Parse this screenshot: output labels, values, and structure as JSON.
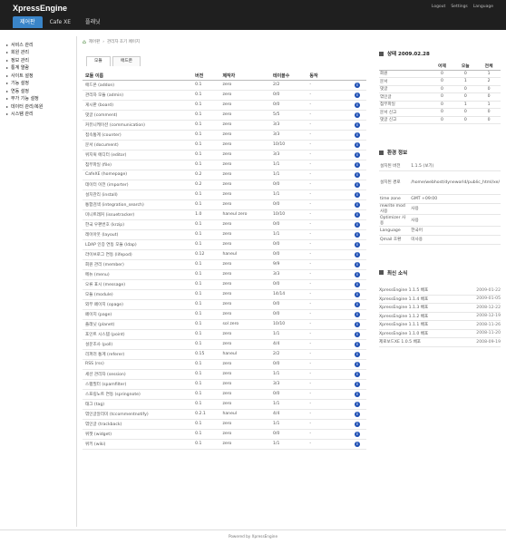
{
  "app": {
    "brand": "XpressEngine",
    "nav": [
      "제어판",
      "Cafe XE",
      "플래닛"
    ],
    "top_links": [
      "Logout",
      "Settings",
      "Language"
    ],
    "footer": "Powered by XpressEngine"
  },
  "sidebar": {
    "items": [
      "서비스 관리",
      "회원 관리",
      "정보 관리",
      "통계 열람",
      "사이트 설정",
      "기능 설정",
      "연동 설정",
      "부가 기능 설정",
      "데이터 관리/복원",
      "시스템 관리"
    ]
  },
  "main": {
    "breadcrumb": [
      "제어판",
      "관리자 초기 페이지"
    ],
    "tabs": [
      "모듈",
      "애드온"
    ],
    "columns": [
      "모듈 이름",
      "버전",
      "제작자",
      "테이블수",
      "동작"
    ],
    "rows": [
      [
        "애드온 (addon)",
        "0.1",
        "zero",
        "2/2",
        "-"
      ],
      [
        "관리자 모듈 (admin)",
        "0.1",
        "zero",
        "0/0",
        "-"
      ],
      [
        "게시판 (board)",
        "0.1",
        "zero",
        "0/0",
        "-"
      ],
      [
        "댓글 (comment)",
        "0.1",
        "zero",
        "5/5",
        "-"
      ],
      [
        "커뮤니케이션 (communication)",
        "0.1",
        "zero",
        "3/3",
        "-"
      ],
      [
        "접속통계 (counter)",
        "0.1",
        "zero",
        "3/3",
        "-"
      ],
      [
        "문서 (document)",
        "0.1",
        "zero",
        "10/10",
        "-"
      ],
      [
        "위지윅 에디터 (editor)",
        "0.1",
        "zero",
        "3/3",
        "-"
      ],
      [
        "첨부파일 (file)",
        "0.1",
        "zero",
        "1/1",
        "-"
      ],
      [
        "CafeXE (homepage)",
        "0.2",
        "zero",
        "1/1",
        "-"
      ],
      [
        "데이터 이전 (importer)",
        "0.2",
        "zero",
        "0/0",
        "-"
      ],
      [
        "설치관리 (install)",
        "0.1",
        "zero",
        "1/1",
        "-"
      ],
      [
        "통합검색 (integration_search)",
        "0.1",
        "zero",
        "0/0",
        "-"
      ],
      [
        "미니트래커 (issuetracker)",
        "1.0",
        "haneul zero",
        "10/10",
        "-"
      ],
      [
        "한국 우편번호 (krzip)",
        "0.1",
        "zero",
        "0/0",
        "-"
      ],
      [
        "레이아웃 (layout)",
        "0.1",
        "zero",
        "1/1",
        "-"
      ],
      [
        "LDAP 인증 연동 모듈 (ldap)",
        "0.1",
        "zero",
        "0/0",
        "-"
      ],
      [
        "라이브로그 연동 (lifepod)",
        "0.12",
        "haneul",
        "0/0",
        "-"
      ],
      [
        "회원 관리 (member)",
        "0.1",
        "zero",
        "9/9",
        "-"
      ],
      [
        "메뉴 (menu)",
        "0.1",
        "zero",
        "3/3",
        "-"
      ],
      [
        "오류 표시 (message)",
        "0.1",
        "zero",
        "0/0",
        "-"
      ],
      [
        "모듈 (module)",
        "0.1",
        "zero",
        "14/14",
        "-"
      ],
      [
        "외부 페이지 (opage)",
        "0.1",
        "zero",
        "0/0",
        "-"
      ],
      [
        "페이지 (page)",
        "0.1",
        "zero",
        "0/0",
        "-"
      ],
      [
        "플래닛 (planet)",
        "0.1",
        "sol zero",
        "10/10",
        "-"
      ],
      [
        "포인트 시스템 (point)",
        "0.1",
        "zero",
        "1/1",
        "-"
      ],
      [
        "설문조사 (poll)",
        "0.1",
        "zero",
        "4/4",
        "-"
      ],
      [
        "리퍼러 통계 (referer)",
        "0.15",
        "haneul",
        "2/2",
        "-"
      ],
      [
        "RSS (rss)",
        "0.1",
        "zero",
        "0/0",
        "-"
      ],
      [
        "세션 관리자 (session)",
        "0.1",
        "zero",
        "1/1",
        "-"
      ],
      [
        "스팸필터 (spamfilter)",
        "0.1",
        "zero",
        "3/3",
        "-"
      ],
      [
        "스프링노트 연동 (springnote)",
        "0.1",
        "zero",
        "0/0",
        "-"
      ],
      [
        "태그 (tag)",
        "0.1",
        "zero",
        "1/1",
        "-"
      ],
      [
        "엮인글알리미 (tccommentnotify)",
        "0.2.1",
        "haneul",
        "4/4",
        "-"
      ],
      [
        "엮인글 (trackback)",
        "0.1",
        "zero",
        "1/1",
        "-"
      ],
      [
        "위젯 (widget)",
        "0.1",
        "zero",
        "0/0",
        "-"
      ],
      [
        "위키 (wiki)",
        "0.1",
        "zero",
        "1/1",
        "-"
      ]
    ]
  },
  "status": {
    "title": "상태 2009.02.28",
    "headers": [
      "",
      "어제",
      "오늘",
      "전체"
    ],
    "rows": [
      [
        "회원",
        "0",
        "0",
        "1"
      ],
      [
        "문서",
        "0",
        "1",
        "2"
      ],
      [
        "댓글",
        "0",
        "0",
        "0"
      ],
      [
        "엮인글",
        "0",
        "0",
        "0"
      ],
      [
        "첨부파일",
        "0",
        "1",
        "1"
      ],
      [
        "문서 신고",
        "0",
        "0",
        "0"
      ],
      [
        "댓글 신고",
        "0",
        "0",
        "0"
      ]
    ]
  },
  "env": {
    "title": "환경 정보",
    "rows": [
      [
        "설치된 버전",
        "1.1.5 (보기)"
      ],
      [
        "설치된 경로",
        "/home/webhost/dyneworld/public_html/xe/"
      ],
      [
        "time zone",
        "GMT +09:00"
      ],
      [
        "rewrite mod 사용",
        "사용"
      ],
      [
        "Optimizer 사용",
        "사용"
      ],
      [
        "Language",
        "한국어"
      ],
      [
        "Qmail 호환",
        "미사용"
      ]
    ]
  },
  "news": {
    "title": "최신 소식",
    "items": [
      [
        "XpressEngine 1.1.5 배포",
        "2009-01-22"
      ],
      [
        "XpressEngine 1.1.4 배포",
        "2009-01-05"
      ],
      [
        "XpressEngine 1.1.3 배포",
        "2008-12-22"
      ],
      [
        "XpressEngine 1.1.2 배포",
        "2008-12-19"
      ],
      [
        "XpressEngine 1.1.1 배포",
        "2008-11-26"
      ],
      [
        "XpressEngine 1.1.0 배포",
        "2008-11-20"
      ],
      [
        "제로보드XE 1.0.5 배포",
        "2008-09-19"
      ]
    ]
  }
}
